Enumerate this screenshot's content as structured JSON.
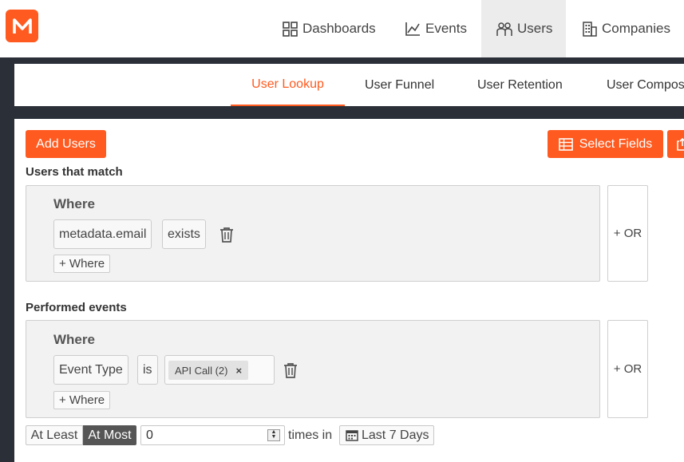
{
  "nav": {
    "items": [
      {
        "label": "Dashboards",
        "icon": "dashboard-grid-icon"
      },
      {
        "label": "Events",
        "icon": "line-chart-icon"
      },
      {
        "label": "Users",
        "icon": "users-icon",
        "active": true
      },
      {
        "label": "Companies",
        "icon": "building-icon"
      }
    ]
  },
  "subnav": {
    "tabs": [
      {
        "label": "User Lookup",
        "active": true
      },
      {
        "label": "User Funnel"
      },
      {
        "label": "User Retention"
      },
      {
        "label": "User Compos"
      }
    ]
  },
  "toolbar": {
    "add_users": "Add Users",
    "select_fields": "Select Fields"
  },
  "users_match": {
    "heading": "Users that match",
    "where_title": "Where",
    "field": "metadata.email",
    "operator": "exists",
    "add_where": "+ Where",
    "or_label": "+ OR"
  },
  "performed": {
    "heading": "Performed events",
    "where_title": "Where",
    "field": "Event Type",
    "operator": "is",
    "value_tag": "API Call (2)",
    "remove_glyph": "×",
    "add_where": "+ Where",
    "or_label": "+ OR"
  },
  "frequency": {
    "at_least": "At Least",
    "at_most": "At Most",
    "at_most_selected": true,
    "count_value": "0",
    "times_in": "times in",
    "date_range": "Last 7 Days"
  },
  "colors": {
    "accent": "#ff5a1f",
    "dark_bg": "#2a2f38",
    "selected_segment": "#555555"
  }
}
